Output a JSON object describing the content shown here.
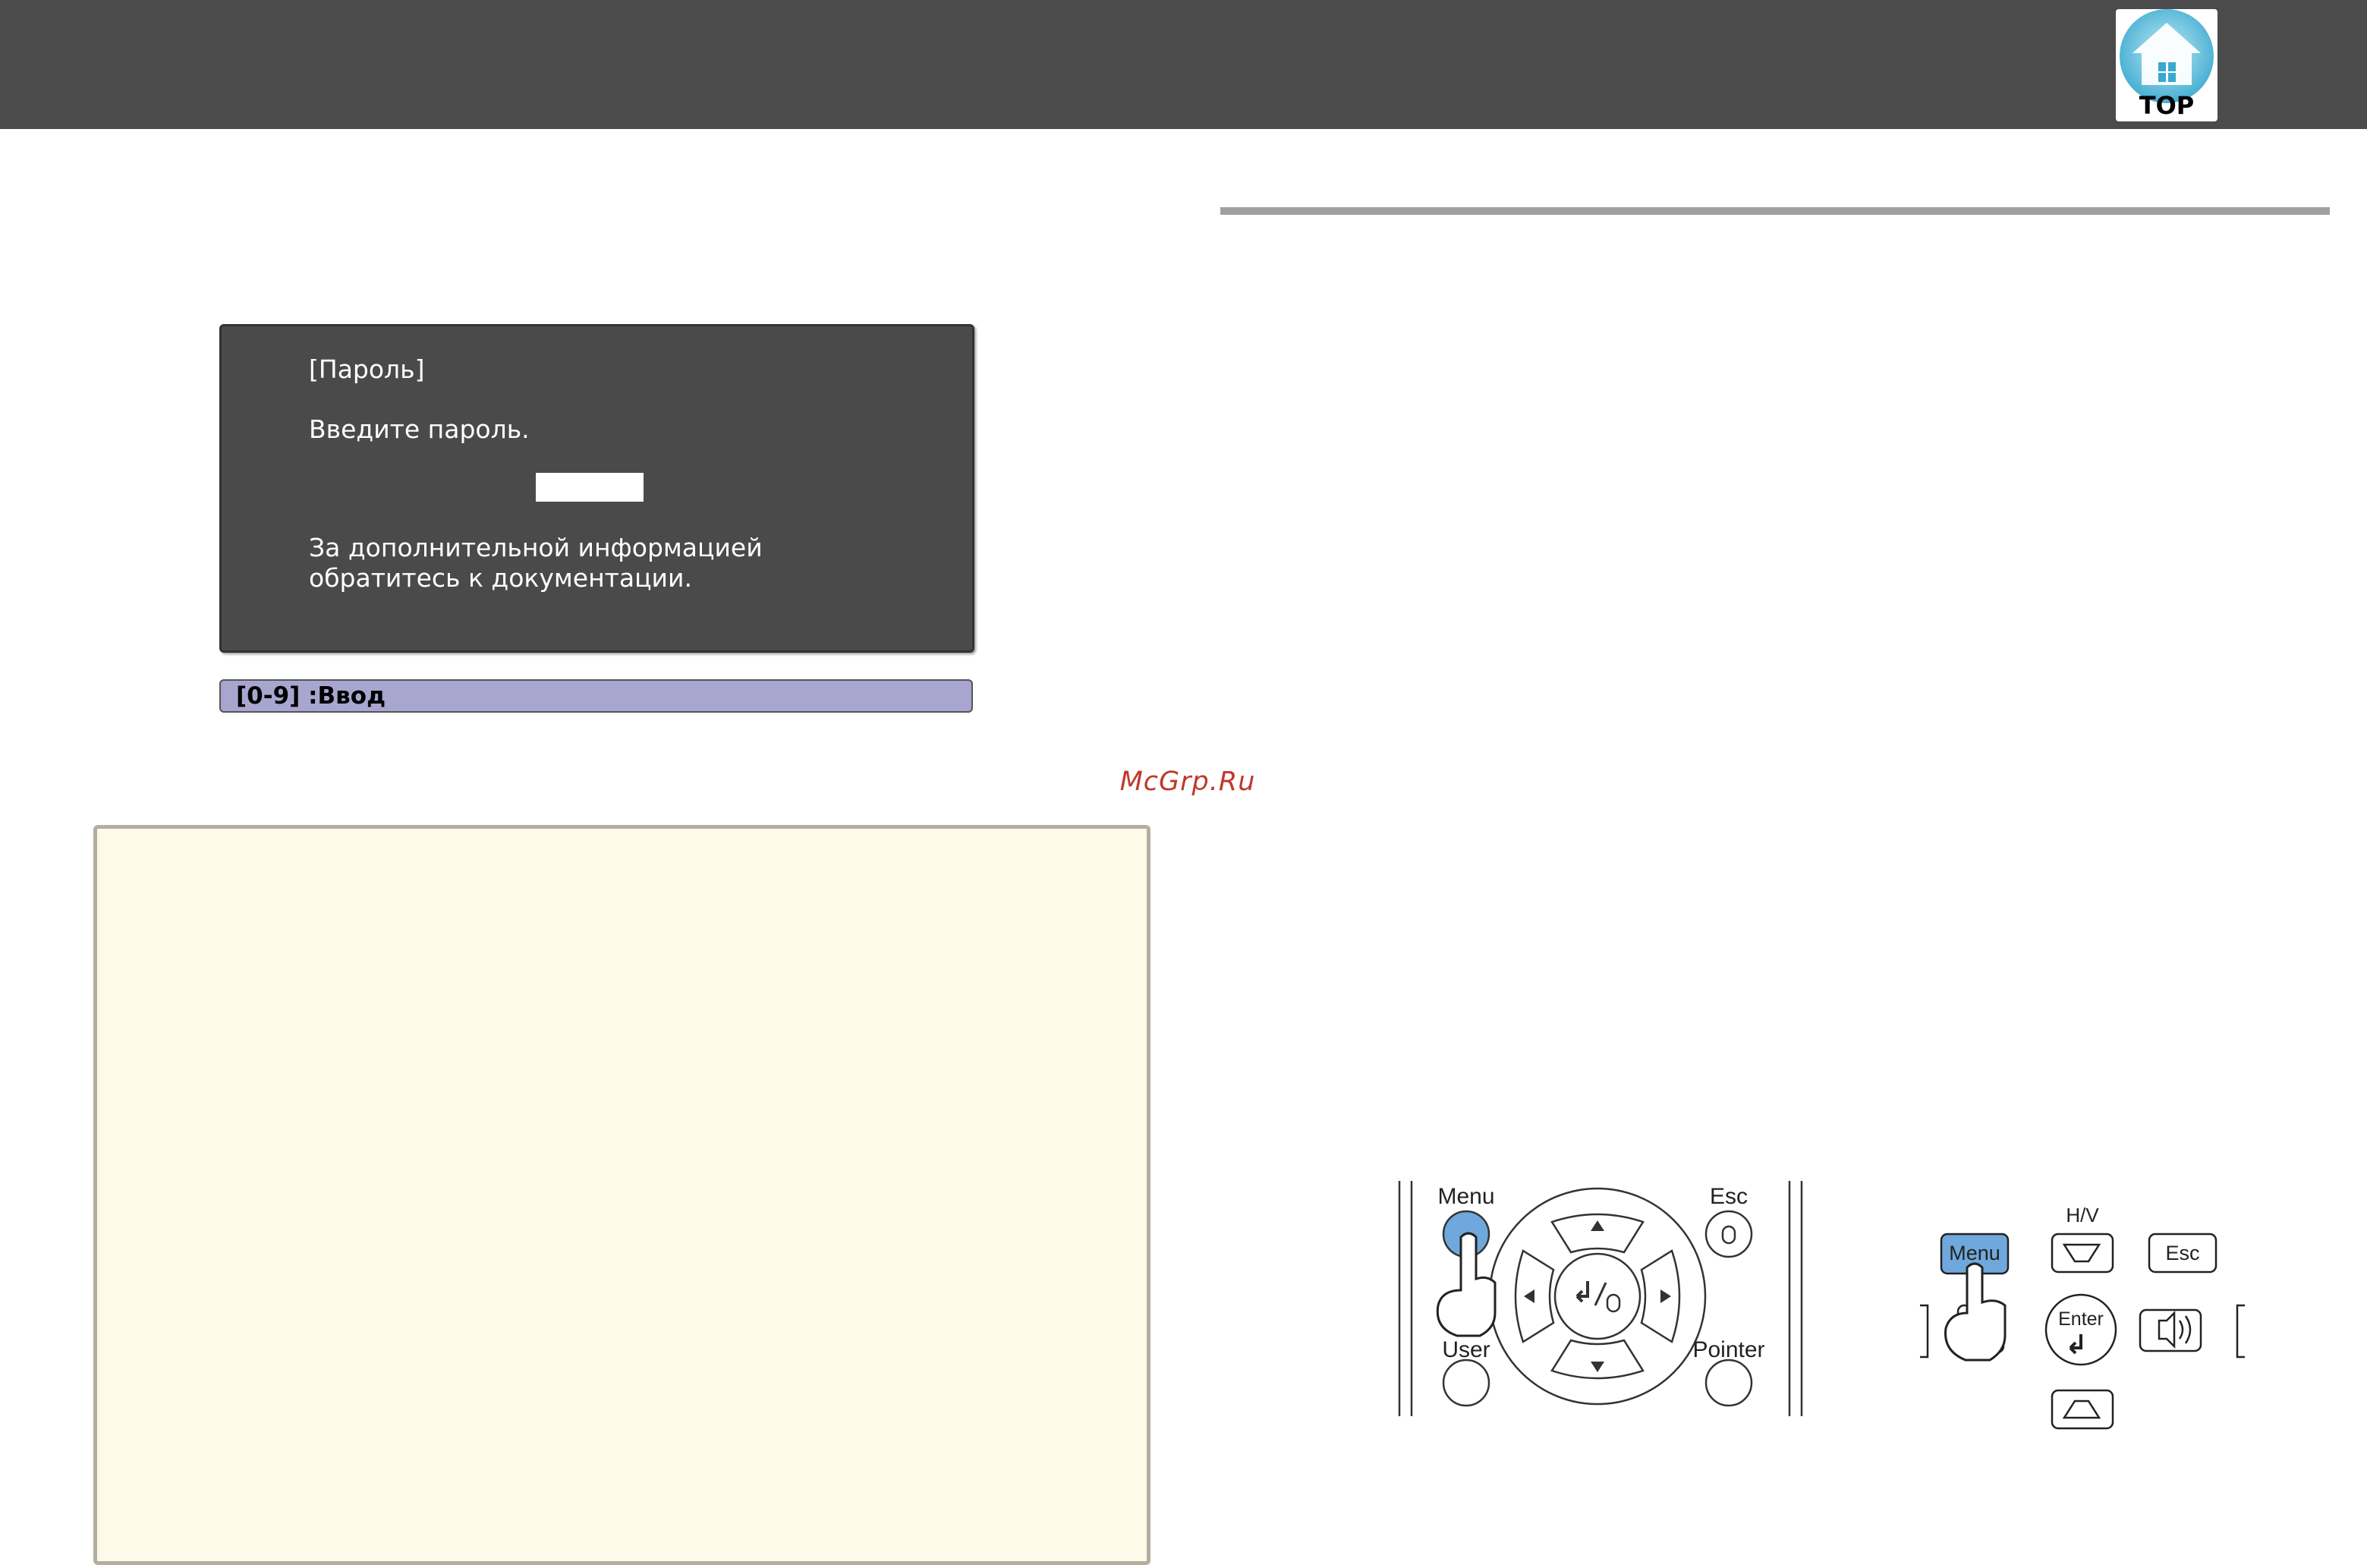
{
  "header": {
    "logo_label": "TOP"
  },
  "password_dialog": {
    "title": "[Пароль]",
    "prompt": "Введите пароль.",
    "info_line1": "За дополнительной информацией",
    "info_line2": "обратитесь к документации."
  },
  "hint_bar": {
    "text": "[0-9] :Ввод"
  },
  "watermark": "McGrp.Ru",
  "remote_control": {
    "menu_label": "Menu",
    "esc_label": "Esc",
    "user_label": "User",
    "pointer_label": "Pointer"
  },
  "control_panel": {
    "menu_label": "Menu",
    "hv_label": "H/V",
    "esc_label": "Esc",
    "enter_label": "Enter"
  }
}
